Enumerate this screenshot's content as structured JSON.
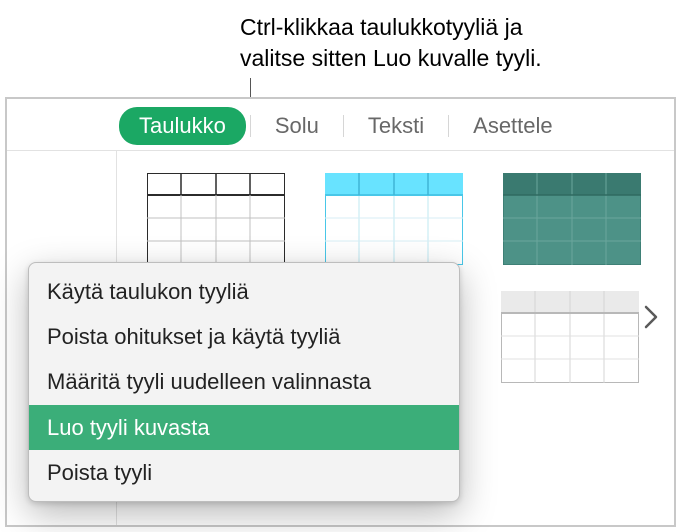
{
  "annotation": {
    "line1": "Ctrl-klikkaa taulukkotyyliä ja",
    "line2": "valitse sitten Luo kuvalle tyyli."
  },
  "tabs": {
    "items": [
      {
        "label": "Taulukko",
        "active": true
      },
      {
        "label": "Solu",
        "active": false
      },
      {
        "label": "Teksti",
        "active": false
      },
      {
        "label": "Asettele",
        "active": false
      }
    ]
  },
  "context_menu": {
    "items": [
      {
        "label": "Käytä taulukon tyyliä",
        "highlight": false
      },
      {
        "label": "Poista ohitukset ja käytä tyyliä",
        "highlight": false
      },
      {
        "label": "Määritä tyyli uudelleen valinnasta",
        "highlight": false
      },
      {
        "label": "Luo tyyli kuvasta",
        "highlight": true
      },
      {
        "label": "Poista tyyli",
        "highlight": false
      }
    ]
  },
  "style_thumbs": {
    "row1": [
      "plain-white",
      "cyan-header",
      "teal-solid"
    ],
    "row2": [
      "plain-grey"
    ]
  },
  "pager": {
    "count": 2,
    "active": 0
  }
}
